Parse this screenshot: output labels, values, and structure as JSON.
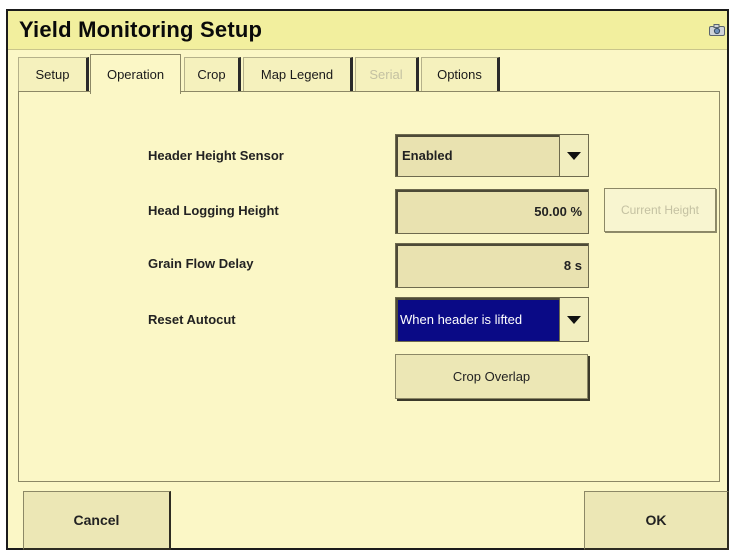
{
  "window": {
    "title": "Yield Monitoring Setup",
    "screenshot_icon": "camera-icon"
  },
  "tabs": [
    {
      "label": "Setup",
      "active": false,
      "enabled": true
    },
    {
      "label": "Operation",
      "active": true,
      "enabled": true
    },
    {
      "label": "Crop",
      "active": false,
      "enabled": true
    },
    {
      "label": "Map Legend",
      "active": false,
      "enabled": true
    },
    {
      "label": "Serial",
      "active": false,
      "enabled": false
    },
    {
      "label": "Options",
      "active": false,
      "enabled": true
    }
  ],
  "form": {
    "header_height_sensor": {
      "label": "Header Height Sensor",
      "value": "Enabled"
    },
    "head_logging_height": {
      "label": "Head Logging Height",
      "value": "50.00 %",
      "button": "Current Height"
    },
    "grain_flow_delay": {
      "label": "Grain Flow Delay",
      "value": "8 s"
    },
    "reset_autocut": {
      "label": "Reset Autocut",
      "value": "When header is lifted"
    },
    "crop_overlap_button": "Crop Overlap"
  },
  "footer": {
    "cancel": "Cancel",
    "ok": "OK"
  },
  "colors": {
    "background": "#fbf7c6",
    "selected": "#0a0a86"
  }
}
